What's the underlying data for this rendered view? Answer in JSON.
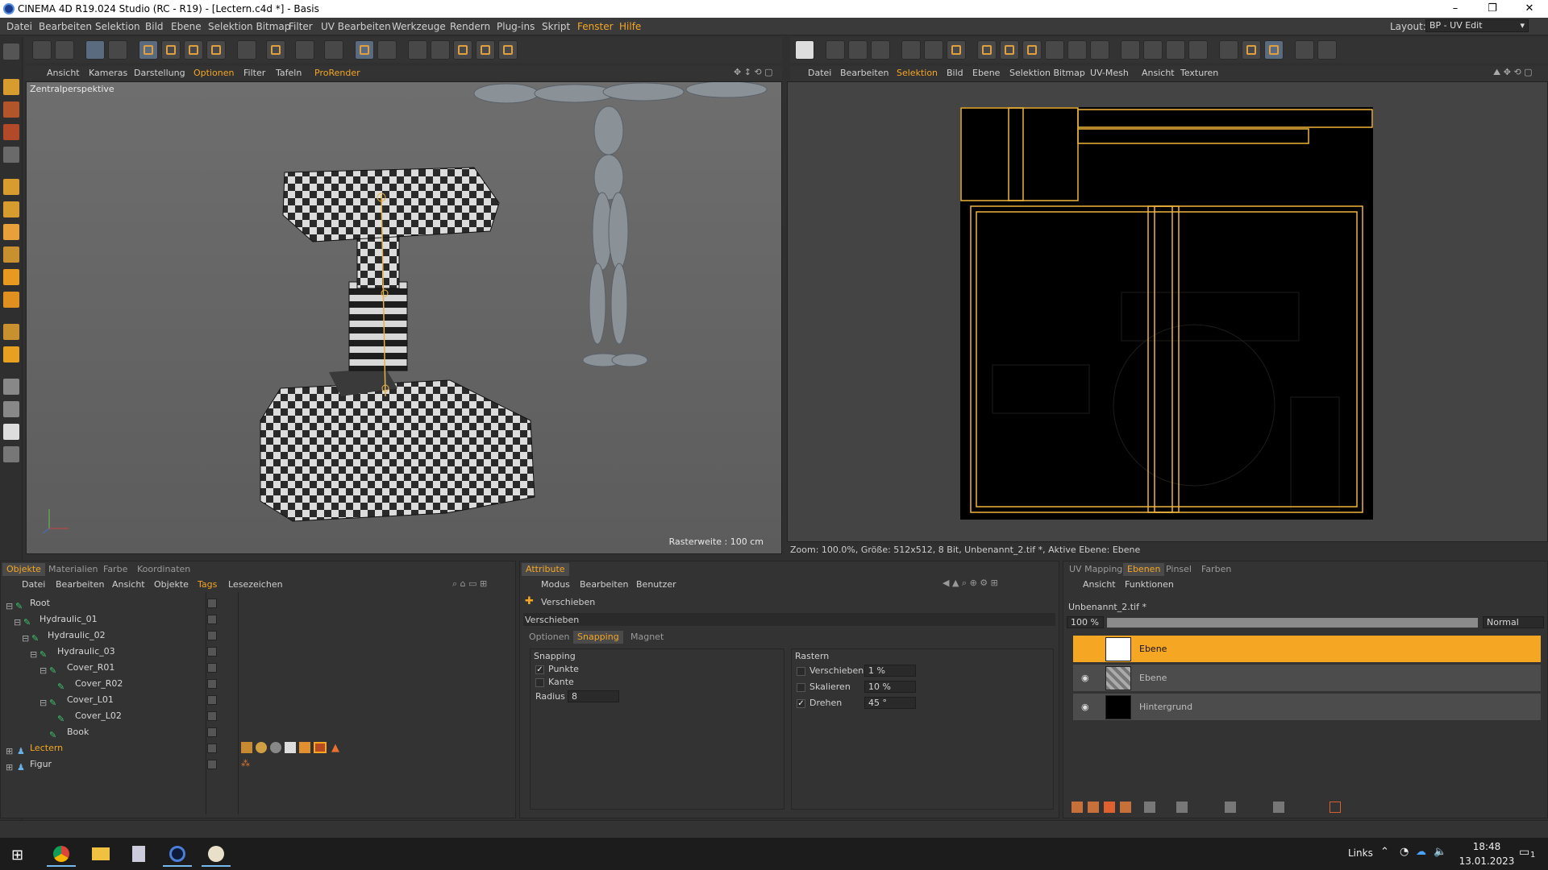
{
  "title": "CINEMA 4D R19.024 Studio (RC - R19) - [Lectern.c4d *] - Basis",
  "window_buttons": [
    "–",
    "❐",
    "✕"
  ],
  "menu": [
    "Datei",
    "Bearbeiten",
    "Selektion",
    "Bild",
    "Ebene",
    "Selektion Bitmap",
    "Filter",
    "UV Bearbeiten",
    "Werkzeuge",
    "Rendern",
    "Plug-ins",
    "Skript",
    "Fenster",
    "Hilfe"
  ],
  "layout": {
    "label": "Layout:",
    "value": "BP - UV Edit"
  },
  "viewport": {
    "menu": [
      "Ansicht",
      "Kameras",
      "Darstellung",
      "Optionen",
      "Filter",
      "Tafeln",
      "ProRender"
    ],
    "name": "Zentralperspektive",
    "raster": "Rasterweite : 100 cm"
  },
  "uv_editor": {
    "menu": [
      "Datei",
      "Bearbeiten",
      "Selektion",
      "Bild",
      "Ebene",
      "Selektion Bitmap",
      "UV-Mesh",
      "Ansicht",
      "Texturen"
    ],
    "status": "Zoom: 100.0%, Größe: 512x512, 8 Bit, Unbenannt_2.tif *, Aktive Ebene: Ebene"
  },
  "objects_panel": {
    "tabs": [
      "Objekte",
      "Materialien",
      "Farbe",
      "Koordinaten"
    ],
    "menu": [
      "Datei",
      "Bearbeiten",
      "Ansicht",
      "Objekte",
      "Tags",
      "Lesezeichen"
    ],
    "items": [
      {
        "name": "Root",
        "depth": 0
      },
      {
        "name": "Hydraulic_01",
        "depth": 1
      },
      {
        "name": "Hydraulic_02",
        "depth": 2
      },
      {
        "name": "Hydraulic_03",
        "depth": 3
      },
      {
        "name": "Cover_R01",
        "depth": 4
      },
      {
        "name": "Cover_R02",
        "depth": 5
      },
      {
        "name": "Cover_L01",
        "depth": 4
      },
      {
        "name": "Cover_L02",
        "depth": 5
      },
      {
        "name": "Book",
        "depth": 4
      },
      {
        "name": "Lectern",
        "depth": 0
      },
      {
        "name": "Figur",
        "depth": 0
      }
    ]
  },
  "attributes_panel": {
    "tab": "Attribute",
    "menu": [
      "Modus",
      "Bearbeiten",
      "Benutzer"
    ],
    "tool": "Verschieben",
    "section": "Verschieben",
    "subtabs": [
      "Optionen",
      "Snapping",
      "Magnet"
    ],
    "snapping": {
      "title": "Snapping",
      "punkte": "Punkte",
      "kante": "Kante",
      "radius_label": "Radius",
      "radius_value": "8"
    },
    "rastern": {
      "title": "Rastern",
      "verschieben": "Verschieben",
      "verschieben_val": "1 %",
      "skalieren": "Skalieren",
      "skalieren_val": "10 %",
      "drehen": "Drehen",
      "drehen_val": "45 °"
    }
  },
  "layers_panel": {
    "tabs": [
      "UV Mapping",
      "Ebenen",
      "Pinsel",
      "Farben"
    ],
    "menu": [
      "Ansicht",
      "Funktionen"
    ],
    "file": "Unbenannt_2.tif *",
    "opacity": "100 %",
    "blend": "Normal",
    "layers": [
      "Ebene",
      "Ebene",
      "Hintergrund"
    ]
  },
  "taskbar": {
    "links": "Links",
    "time": "18:48",
    "date": "13.01.2023",
    "notify": "1"
  }
}
